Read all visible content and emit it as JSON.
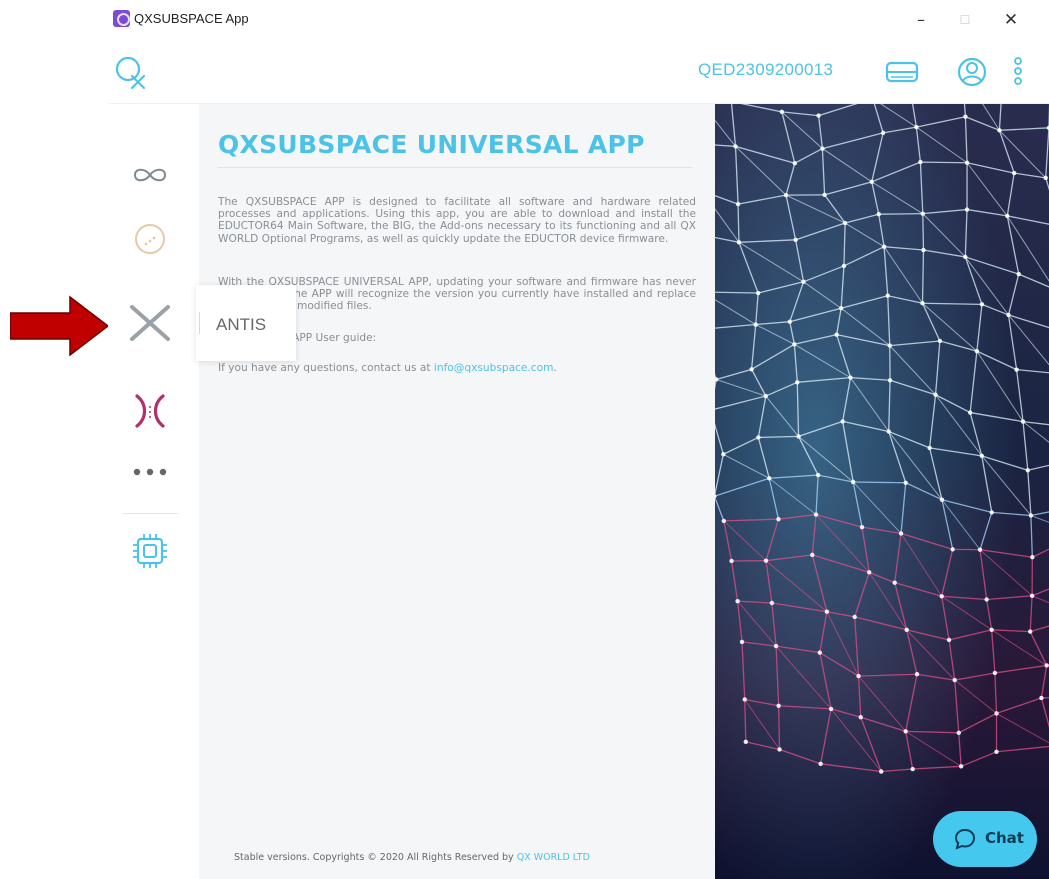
{
  "window": {
    "title": "QXSUBSPACE App",
    "minimize_glyph": "–",
    "maximize_glyph": "☐",
    "close_glyph": "✕"
  },
  "header": {
    "device_id": "QED2309200013",
    "icons": [
      "drive-icon",
      "user-icon",
      "kebab-menu-icon"
    ]
  },
  "sidebar": {
    "items": [
      {
        "name": "infinity-icon"
      },
      {
        "name": "circle-dots-icon"
      },
      {
        "name": "cross-icon",
        "tooltip": "ANTIS"
      },
      {
        "name": "brackets-icon"
      },
      {
        "name": "more-dots-icon"
      },
      {
        "name": "chip-icon"
      }
    ]
  },
  "content": {
    "title": "QXSUBSPACE UNIVERSAL APP",
    "p1": "The QXSUBSPACE APP is designed to facilitate all software and hardware related processes and applications. Using this app, you are able to download and install the EDUCTOR64 Main Software, the BIG, the Add-ons necessary to its functioning and all QX WORLD Optional Programs, as well as quickly update the EDUCTOR device firmware.",
    "p2": "With the QXSUBSPACE UNIVERSAL APP, updating your software and firmware has never been easier. The APP will recognize the version you currently have installed and replace the missing or modified files.",
    "p3": "QXSUBSPACE APP User guide:",
    "p4_prefix": "If you have any questions, contact us at ",
    "p4_email": "info@qxsubspace.com",
    "p4_suffix": ".",
    "footer_prefix": "Stable versions. Copyrights © 2020 All Rights Reserved by ",
    "footer_link": "QX WORLD LTD"
  },
  "chat": {
    "label": "Chat"
  },
  "colors": {
    "accent": "#4cc3e6",
    "arrow": "#c00000",
    "brackets": "#b0306a"
  }
}
